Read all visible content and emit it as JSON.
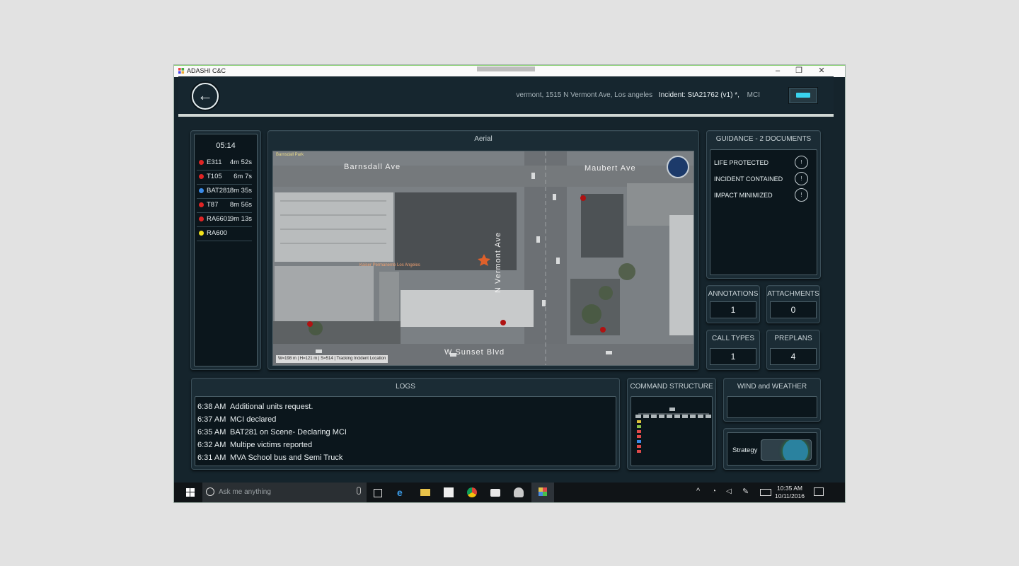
{
  "window": {
    "title": "ADASHI C&C",
    "controls": [
      "–",
      "❐",
      "✕"
    ]
  },
  "header": {
    "back_icon": "back-arrow-icon",
    "address": "vermont, 1515 N Vermont Ave, Los angeles",
    "incident": "Incident: StA21762 (v1) *,",
    "incident_type": "MCI",
    "accent": "#39d3ee"
  },
  "units": {
    "timer": "05:14",
    "items": [
      {
        "name": "E311",
        "time": "4m 52s",
        "color": "#e02424"
      },
      {
        "name": "T105",
        "time": "6m 7s",
        "color": "#e02424"
      },
      {
        "name": "BAT281",
        "time": "8m 35s",
        "color": "#3a8be8"
      },
      {
        "name": "T87",
        "time": "8m 56s",
        "color": "#e02424"
      },
      {
        "name": "RA6601",
        "time": "9m 13s",
        "color": "#e02424"
      },
      {
        "name": "RA600",
        "time": "",
        "color": "#f2e21a"
      }
    ]
  },
  "aerial": {
    "title": "Aerial",
    "labels": {
      "park": "Barnsdall Park",
      "barnsdall": "Barnsdall Ave",
      "maubert": "Maubert Ave",
      "vermont": "N Vermont Ave",
      "sunset": "W Sunset Blvd",
      "business": "Kaiser Permanente Los Angeles"
    },
    "status": [
      "W=198 m",
      "H=121 m",
      "S=514",
      "Tracking Incident Location"
    ],
    "compass_icon": "compass-icon"
  },
  "guidance": {
    "title": "GUIDANCE - 2 DOCUMENTS",
    "items": [
      "LIFE PROTECTED",
      "INCIDENT CONTAINED",
      "IMPACT MINIMIZED"
    ],
    "info_glyph": "!"
  },
  "stats": {
    "annotations": {
      "label": "ANNOTATIONS",
      "value": "1"
    },
    "attachments": {
      "label": "ATTACHMENTS",
      "value": "0"
    },
    "call_types": {
      "label": "CALL TYPES",
      "value": "1"
    },
    "preplans": {
      "label": "PREPLANS",
      "value": "4"
    }
  },
  "logs": {
    "title": "LOGS",
    "entries": [
      {
        "time": "6:38 AM",
        "text": "Additional units request."
      },
      {
        "time": "6:37 AM",
        "text": "MCI declared"
      },
      {
        "time": "6:35 AM",
        "text": "BAT281 on Scene- Declaring MCI"
      },
      {
        "time": "6:32 AM",
        "text": "Multipe victims reported"
      },
      {
        "time": "6:31 AM",
        "text": "MVA School bus and Semi Truck"
      }
    ]
  },
  "command": {
    "title": "COMMAND STRUCTURE"
  },
  "weather": {
    "title": "WIND and WEATHER"
  },
  "strategy": {
    "label": "Strategy"
  },
  "taskbar": {
    "search_placeholder": "Ask me anything",
    "time": "10:35 AM",
    "date": "10/11/2016"
  }
}
